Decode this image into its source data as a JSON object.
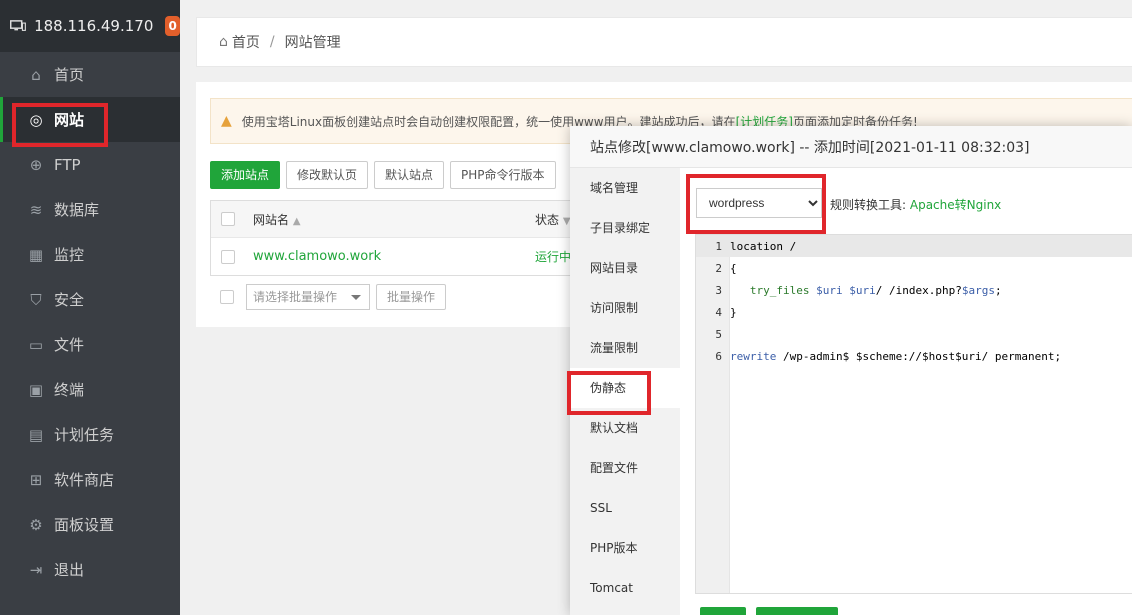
{
  "sidebar": {
    "ip": "188.116.49.170",
    "badge": "0",
    "items": [
      {
        "label": "首页",
        "icon": "home-icon"
      },
      {
        "label": "网站",
        "icon": "globe-icon"
      },
      {
        "label": "FTP",
        "icon": "ftp-icon"
      },
      {
        "label": "数据库",
        "icon": "database-icon"
      },
      {
        "label": "监控",
        "icon": "monitor-chart-icon"
      },
      {
        "label": "安全",
        "icon": "shield-icon"
      },
      {
        "label": "文件",
        "icon": "folder-icon"
      },
      {
        "label": "终端",
        "icon": "terminal-icon"
      },
      {
        "label": "计划任务",
        "icon": "calendar-icon"
      },
      {
        "label": "软件商店",
        "icon": "grid-icon"
      },
      {
        "label": "面板设置",
        "icon": "gear-icon"
      },
      {
        "label": "退出",
        "icon": "logout-icon"
      }
    ]
  },
  "breadcrumb": {
    "home": "首页",
    "sep": "/",
    "current": "网站管理"
  },
  "alert": {
    "text_before": "使用宝塔Linux面板创建站点时会自动创建权限配置，统一使用www用户。建站成功后，请在",
    "link": "[计划任务]",
    "text_after": "页面添加定时备份任务!"
  },
  "toolbar": {
    "add_site": "添加站点",
    "edit_default_page": "修改默认页",
    "default_site": "默认站点",
    "php_cli_version": "PHP命令行版本"
  },
  "table": {
    "col_name": "网站名",
    "col_status": "状态",
    "rows": [
      {
        "name": "www.clamowo.work",
        "status": "运行中"
      }
    ]
  },
  "batch": {
    "placeholder": "请选择批量操作",
    "button": "批量操作"
  },
  "modal": {
    "title": "站点修改[www.clamowo.work] -- 添加时间[2021-01-11 08:32:03]",
    "tabs": [
      "域名管理",
      "子目录绑定",
      "网站目录",
      "访问限制",
      "流量限制",
      "伪静态",
      "默认文档",
      "配置文件",
      "SSL",
      "PHP版本",
      "Tomcat"
    ],
    "active_tab": "伪静态",
    "template_value": "wordpress",
    "tool_label": "规则转换工具:",
    "tool_link": "Apache转Nginx",
    "code_lines": [
      "1",
      "2",
      "3",
      "4",
      "5",
      "6"
    ]
  },
  "colors": {
    "accent": "#20a53a",
    "highlight": "#e0262b"
  }
}
